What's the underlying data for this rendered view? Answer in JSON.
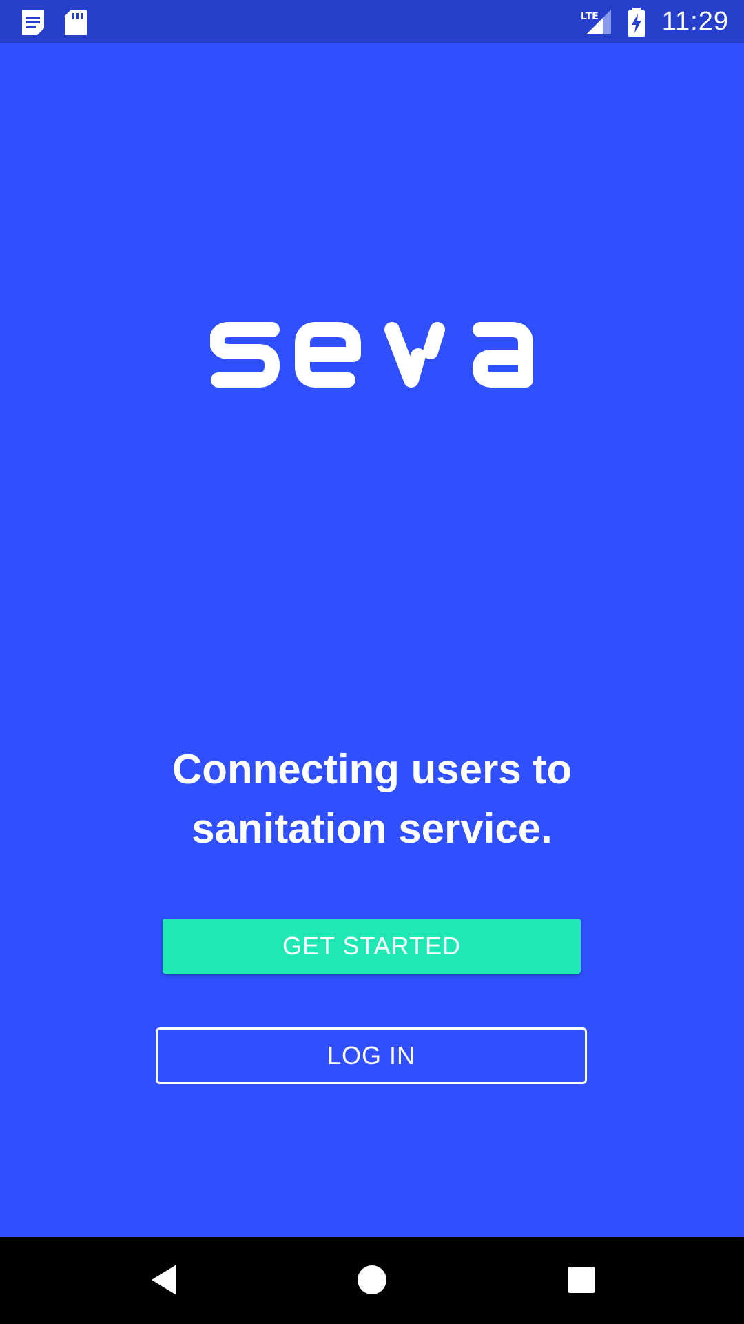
{
  "status_bar": {
    "time": "11:29",
    "network_label": "LTE",
    "icons": [
      "document-notification-icon",
      "sd-card-icon",
      "lte-signal-icon",
      "battery-charging-icon"
    ]
  },
  "brand": {
    "logo_text": "seva"
  },
  "welcome": {
    "tagline": "Connecting users to sanitation service."
  },
  "actions": {
    "get_started_label": "GET STARTED",
    "log_in_label": "LOG IN"
  },
  "colors": {
    "background": "#3050FF",
    "status_bar": "#2740CC",
    "primary_button": "#20E8B4",
    "text": "#FFFFFF",
    "nav_bar": "#000000"
  },
  "navigation": {
    "buttons": [
      "back-icon",
      "home-icon",
      "recent-apps-icon"
    ]
  }
}
